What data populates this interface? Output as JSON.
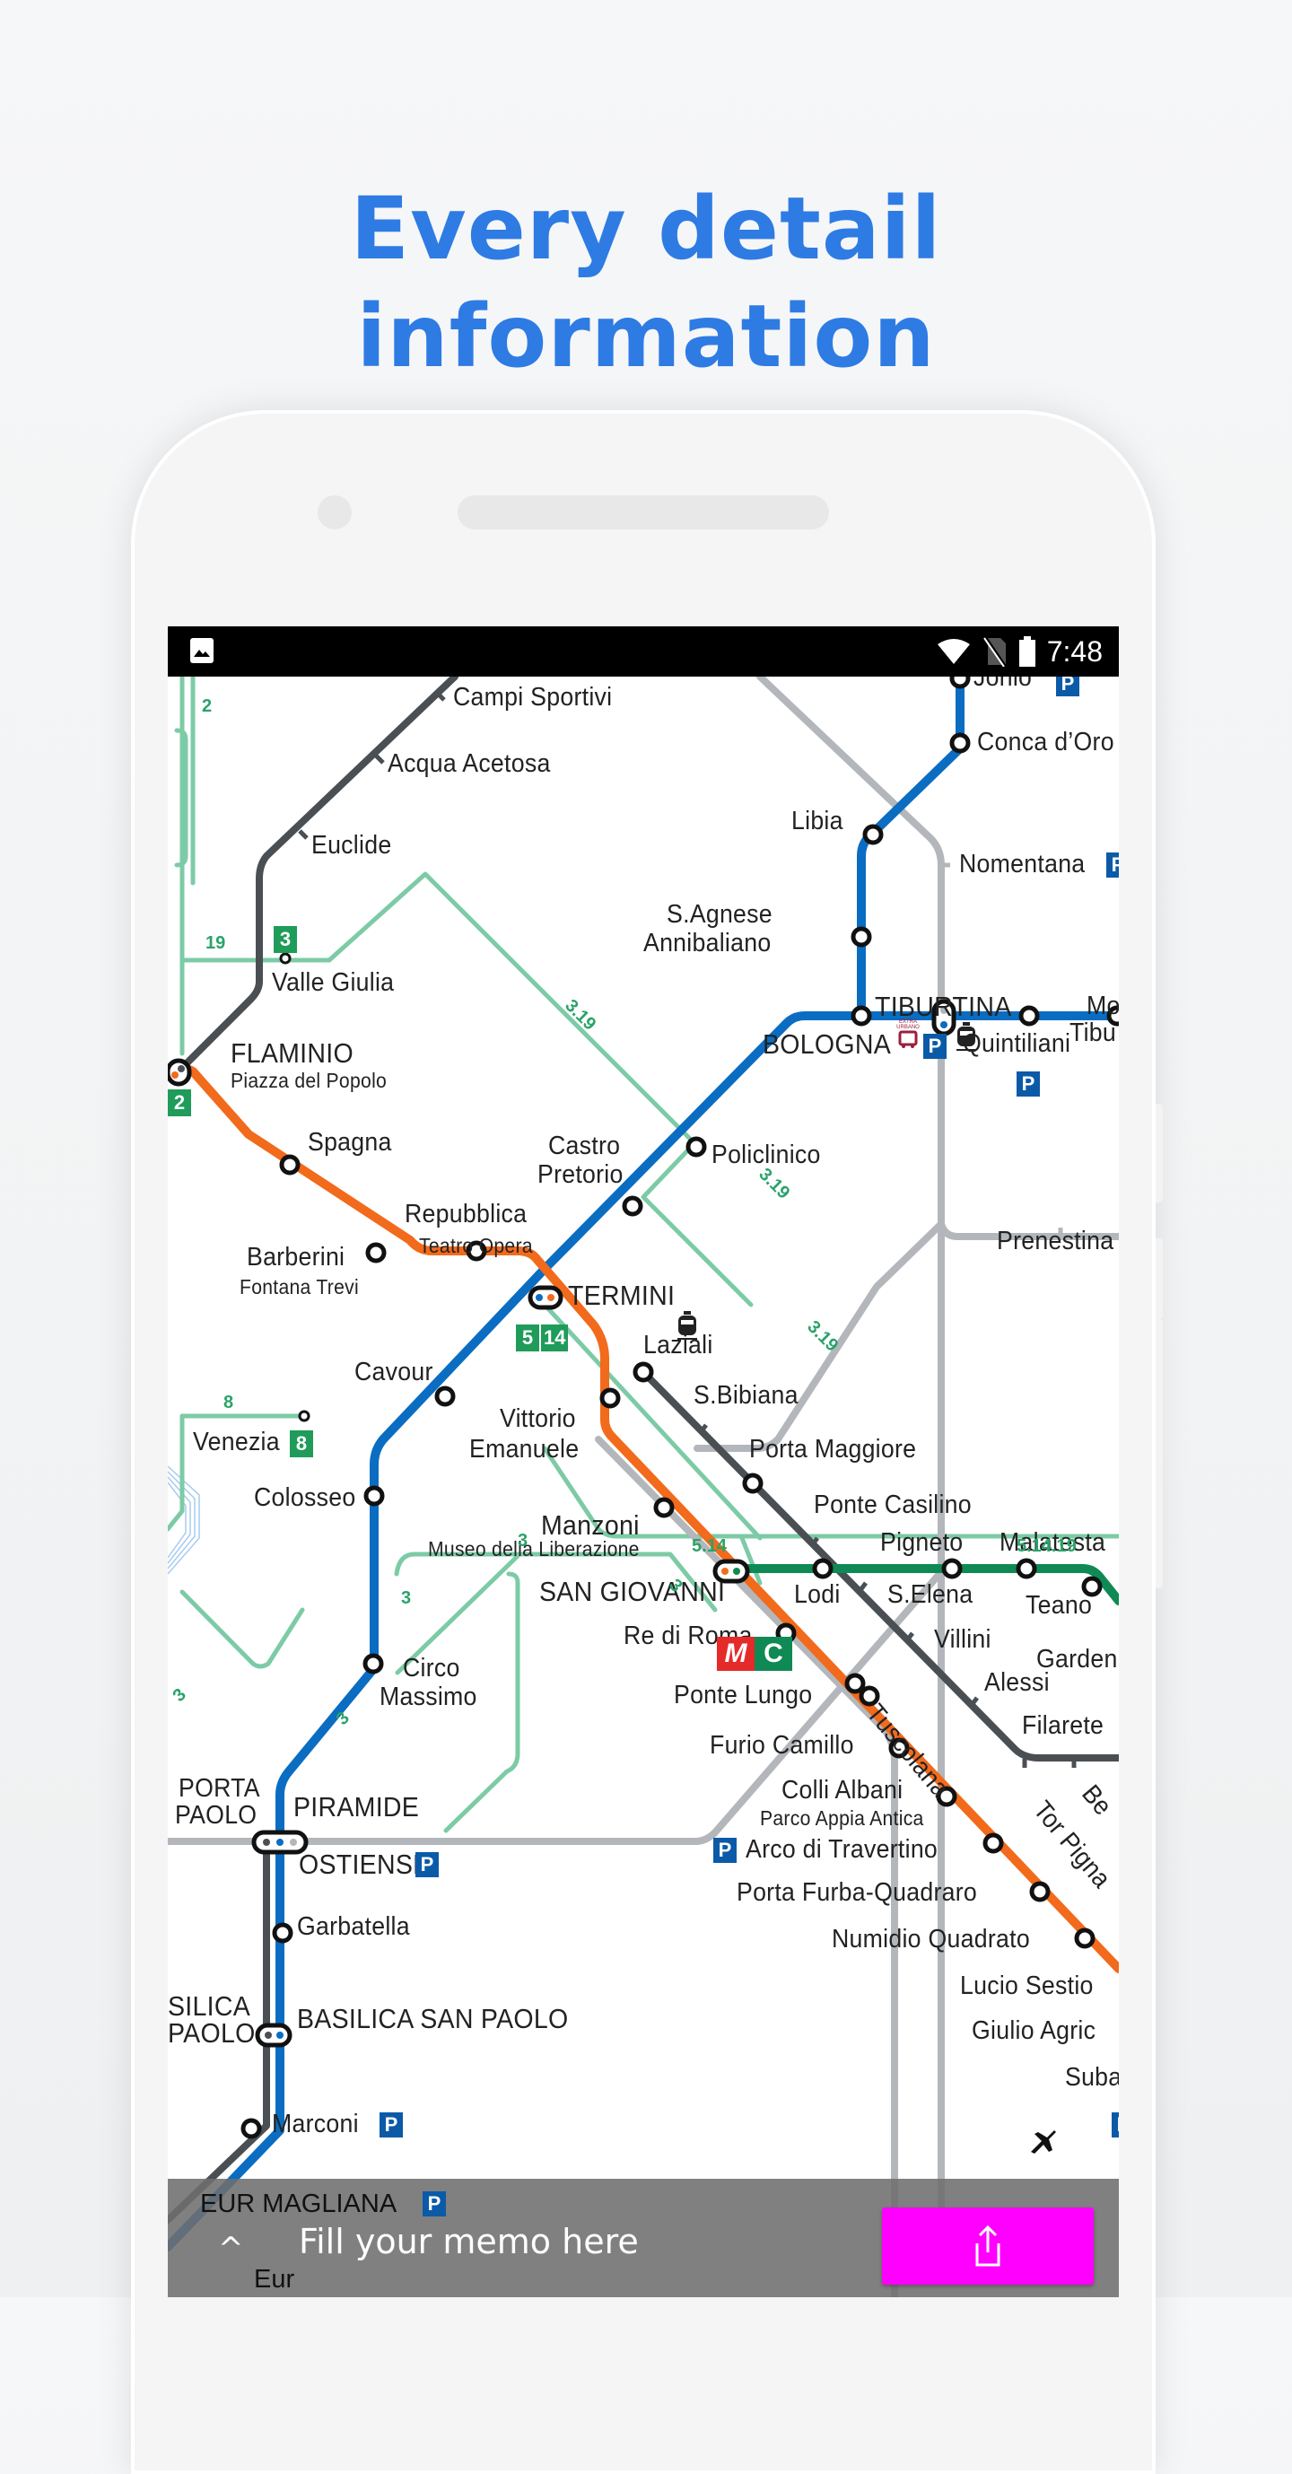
{
  "headline": {
    "line1": "Every detail",
    "line2": "information"
  },
  "status_bar": {
    "time": "7:48",
    "icons": [
      "image-icon",
      "wifi-icon",
      "no-sim-icon",
      "battery-icon"
    ]
  },
  "colors": {
    "headline": "#2e7be4",
    "line_a": "#f26a1b",
    "line_b": "#0a6dc2",
    "line_c": "#0f8a54",
    "tram": "#7ccba6",
    "rail_dark": "#4a4f54",
    "rail_grey": "#b3b7bb",
    "share_button": "#ff00ff",
    "parking": "#0b5aa8"
  },
  "map": {
    "stations": {
      "campi_sportivi": "Campi Sportivi",
      "acqua_acetosa": "Acqua Acetosa",
      "euclide": "Euclide",
      "valle_giulia": "Valle Giulia",
      "flaminio": "FLAMINIO",
      "flaminio_sub": "Piazza del Popolo",
      "spagna": "Spagna",
      "barberini": "Barberini",
      "barberini_sub": "Fontana Trevi",
      "repubblica": "Repubblica",
      "repubblica_sub": "Teatro Opera",
      "termini": "TERMINI",
      "castro_pretorio_1": "Castro",
      "castro_pretorio_2": "Pretorio",
      "policlinico": "Policlinico",
      "bologna": "BOLOGNA",
      "tiburtina": "TIBURTINA",
      "quintiliani": "Quintiliani",
      "monti_tiburtini_1": "Mo",
      "monti_tiburtini_2": "Tibu",
      "jonio": "Jonio",
      "conca_doro": "Conca d’Oro",
      "libia": "Libia",
      "s_agnese_1": "S.Agnese",
      "s_agnese_2": "Annibaliano",
      "nomentana": "Nomentana",
      "prenestina": "Prenestina",
      "laziali": "Laziali",
      "s_bibiana": "S.Bibiana",
      "porta_maggiore": "Porta Maggiore",
      "cavour": "Cavour",
      "vittorio_1": "Vittorio",
      "vittorio_2": "Emanuele",
      "venezia": "Venezia",
      "colosseo": "Colosseo",
      "manzoni": "Manzoni",
      "manzoni_sub": "Museo della Liberazione",
      "san_giovanni": "SAN GIOVANNI",
      "ponte_casilino": "Ponte Casilino",
      "pigneto": "Pigneto",
      "malatesta": "Malatesta",
      "lodi": "Lodi",
      "s_elena": "S.Elena",
      "teano": "Teano",
      "villini": "Villini",
      "gardenie": "Garden",
      "alessi": "Alessi",
      "filarete": "Filarete",
      "re_di_roma": "Re di Roma",
      "ponte_lungo": "Ponte Lungo",
      "tuscolana": "Tuscolana",
      "furio_camillo": "Furio Camillo",
      "colli_albani": "Colli Albani",
      "colli_albani_sub": "Parco Appia Antica",
      "arco_travertino": "Arco di Travertino",
      "porta_furba": "Porta Furba-Quadraro",
      "numidio": "Numidio Quadrato",
      "lucio_sestio": "Lucio Sestio",
      "giulio_agricola": "Giulio Agric",
      "subaugusta": "Suba",
      "tor_pignattara": "Tor Pigna",
      "bel": "Be",
      "circo_1": "Circo",
      "circo_2": "Massimo",
      "porta_paolo_1": "PORTA",
      "porta_paolo_2": "PAOLO",
      "piramide": "PIRAMIDE",
      "ostiense": "OSTIENSE",
      "garbatella": "Garbatella",
      "basilica_left_1": "SILICA",
      "basilica_left_2": "PAOLO",
      "basilica": "BASILICA SAN PAOLO",
      "marconi": "Marconi",
      "eur_magliana": "EUR MAGLIANA",
      "eur": "Eur"
    },
    "tram_numbers": {
      "n2": "2",
      "n19": "19",
      "n3a": "3",
      "n319a": "3.19",
      "n319b": "3.19",
      "n319c": "3.19",
      "n8": "8",
      "n3b": "3",
      "n3c": "3",
      "n3d": "3",
      "n3e": "3",
      "n3f": "3",
      "n514": "5.14",
      "n51419": "5.14.19",
      "n5": "5"
    },
    "badges": {
      "b3": "3",
      "b2": "2",
      "b8": "8",
      "b5": "5",
      "b14": "14",
      "p": "P",
      "m": "M",
      "c": "C",
      "extra_urbano": "EXTRA URBANO"
    }
  },
  "memo_bar": {
    "placeholder": "Fill your memo here",
    "expand_icon": "chevron-up-icon",
    "share_icon": "share-icon"
  }
}
